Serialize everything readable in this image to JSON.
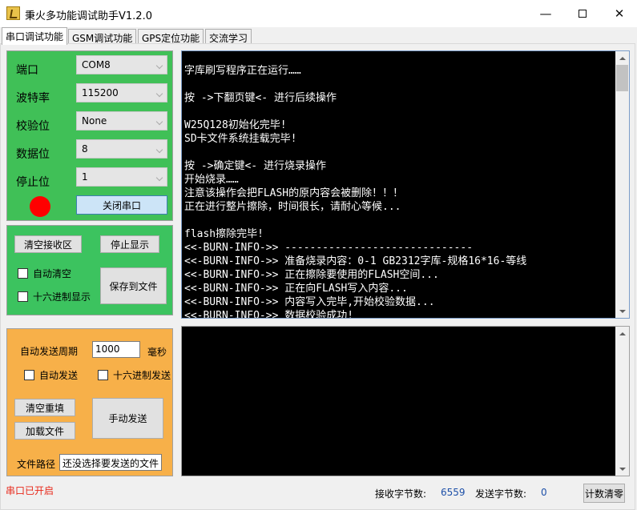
{
  "window": {
    "title": "秉火多功能调试助手V1.2.0",
    "minimize": "—",
    "close": "✕"
  },
  "tabs": [
    {
      "label": "串口调试功能",
      "active": true
    },
    {
      "label": "GSM调试功能",
      "active": false
    },
    {
      "label": "GPS定位功能",
      "active": false
    },
    {
      "label": "交流学习",
      "active": false
    }
  ],
  "serial_settings": {
    "port_label": "端口",
    "port_value": "COM8",
    "baud_label": "波特率",
    "baud_value": "115200",
    "parity_label": "校验位",
    "parity_value": "None",
    "databits_label": "数据位",
    "databits_value": "8",
    "stopbits_label": "停止位",
    "stopbits_value": "1",
    "close_port_button": "关闭串口",
    "status_led_color": "#ff0000"
  },
  "receive_controls": {
    "clear_button": "清空接收区",
    "stop_display_button": "停止显示",
    "auto_clear_label": "自动清空",
    "hex_display_label": "十六进制显示",
    "save_file_button": "保存到文件"
  },
  "send_controls": {
    "period_label": "自动发送周期",
    "period_value": "1000",
    "period_unit": "毫秒",
    "auto_send_label": "自动发送",
    "hex_send_label": "十六进制发送",
    "clear_refill_button": "清空重填",
    "load_file_button": "加载文件",
    "manual_send_button": "手动发送",
    "file_path_label": "文件路径",
    "file_path_value": "还没选择要发送的文件"
  },
  "receive_log": [
    "字库刷写程序正在运行……",
    "",
    "按 ->下翻页键<- 进行后续操作",
    "",
    "W25Q128初始化完毕!",
    "SD卡文件系统挂载完毕!",
    "",
    "按 ->确定键<- 进行烧录操作",
    "开始烧录……",
    "注意该操作会把FLASH的原内容会被删除！！！",
    "正在进行整片擦除，时间很长，请耐心等候...",
    "",
    "flash擦除完毕!",
    "<<-BURN-INFO->> ------------------------------",
    "<<-BURN-INFO->> 准备烧录内容：0-1 GB2312字库-规格16*16-等线",
    "<<-BURN-INFO->> 正在擦除要使用的FLASH空间...",
    "<<-BURN-INFO->> 正在向FLASH写入内容...",
    "<<-BURN-INFO->> 内容写入完毕,开始校验数据...",
    "<<-BURN-INFO->> 数据校验成功!"
  ],
  "status_bar": {
    "port_status": "串口已开启",
    "rx_label": "接收字节数:",
    "rx_value": "6559",
    "tx_label": "发送字节数:",
    "tx_value": "0",
    "reset_count_button": "计数清零"
  }
}
